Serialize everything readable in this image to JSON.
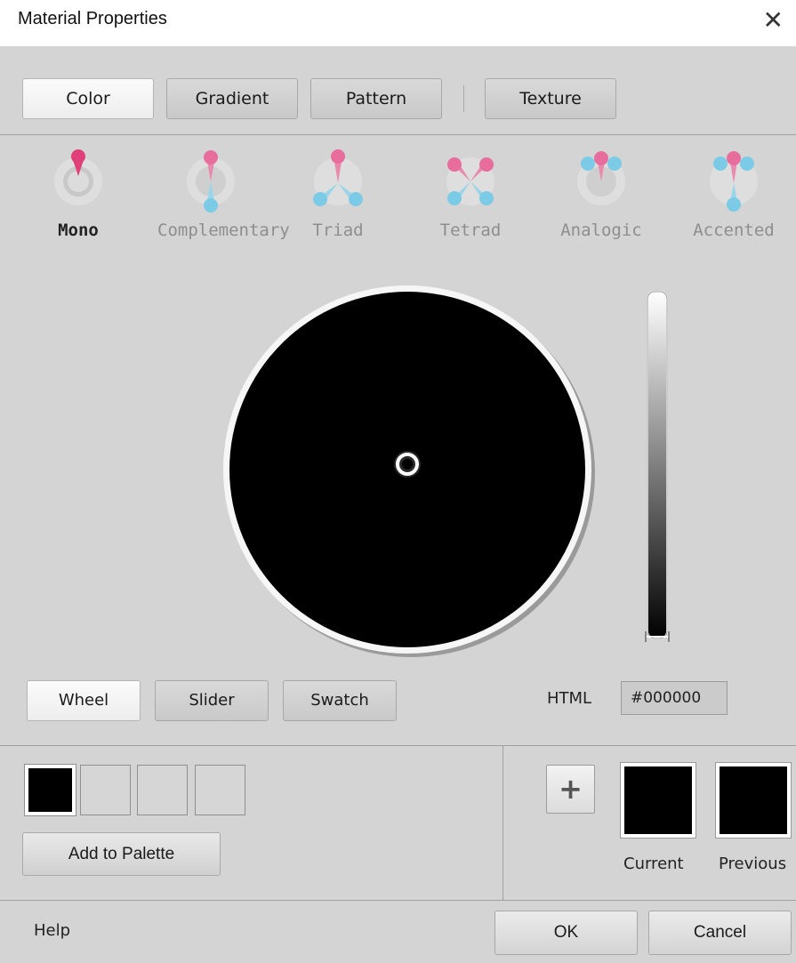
{
  "window": {
    "title": "Material Properties",
    "close_glyph": "✕"
  },
  "tabs": [
    {
      "label": "Color",
      "active": true
    },
    {
      "label": "Gradient",
      "active": false
    },
    {
      "label": "Pattern",
      "active": false
    },
    {
      "label": "Texture",
      "active": false
    }
  ],
  "harmonies": [
    {
      "label": "Mono",
      "icon": "mono-harmony-icon",
      "selected": true
    },
    {
      "label": "Complementary",
      "icon": "complementary-harmony-icon",
      "selected": false
    },
    {
      "label": "Triad",
      "icon": "triad-harmony-icon",
      "selected": false
    },
    {
      "label": "Tetrad",
      "icon": "tetrad-harmony-icon",
      "selected": false
    },
    {
      "label": "Analogic",
      "icon": "analogic-harmony-icon",
      "selected": false
    },
    {
      "label": "Accented",
      "icon": "accented-harmony-icon",
      "selected": false
    }
  ],
  "picker_modes": [
    {
      "label": "Wheel",
      "active": true
    },
    {
      "label": "Slider",
      "active": false
    },
    {
      "label": "Swatch",
      "active": false
    }
  ],
  "html_field": {
    "label": "HTML",
    "value": "#000000"
  },
  "palette": {
    "add_label": "Add to Palette",
    "slots": [
      "#000000",
      "",
      "",
      ""
    ]
  },
  "colors": {
    "current_label": "Current",
    "previous_label": "Previous",
    "current": "#000000",
    "previous": "#000000",
    "accent_pink": "#e0407a",
    "accent_blue": "#6ec6e2"
  },
  "footer": {
    "help_label": "Help",
    "ok_label": "OK",
    "cancel_label": "Cancel"
  }
}
